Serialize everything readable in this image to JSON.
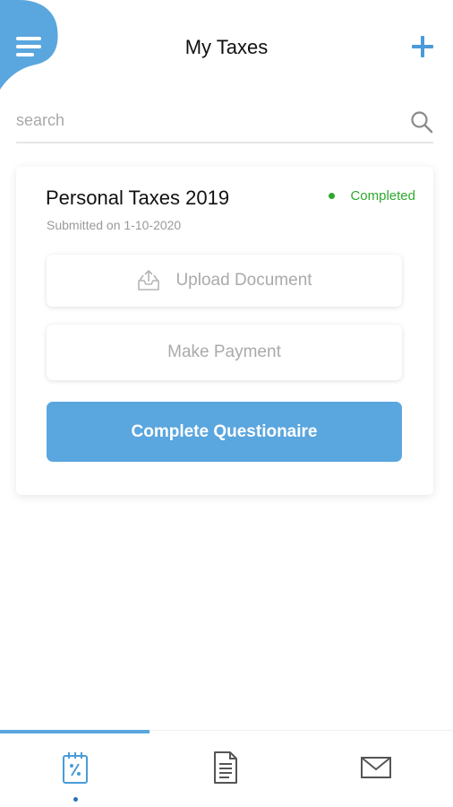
{
  "header": {
    "title": "My Taxes",
    "menu_icon": "hamburger-menu-icon",
    "add_icon": "plus-icon"
  },
  "search": {
    "placeholder": "search",
    "value": "",
    "icon": "search-icon"
  },
  "tax_card": {
    "title": "Personal Taxes 2019",
    "subtitle": "Submitted on 1-10-2020",
    "status": "Completed",
    "status_color": "#2ea82e",
    "buttons": {
      "upload": "Upload Document",
      "payment": "Make Payment",
      "questionnaire": "Complete Questionaire"
    }
  },
  "tab_bar": {
    "active_index": 0,
    "tabs": [
      {
        "icon": "tax-calculator-icon"
      },
      {
        "icon": "document-icon"
      },
      {
        "icon": "mail-icon"
      }
    ]
  },
  "colors": {
    "accent": "#5aa6de",
    "accent_dark": "#4a9bd8",
    "status_green": "#2ea82e"
  }
}
